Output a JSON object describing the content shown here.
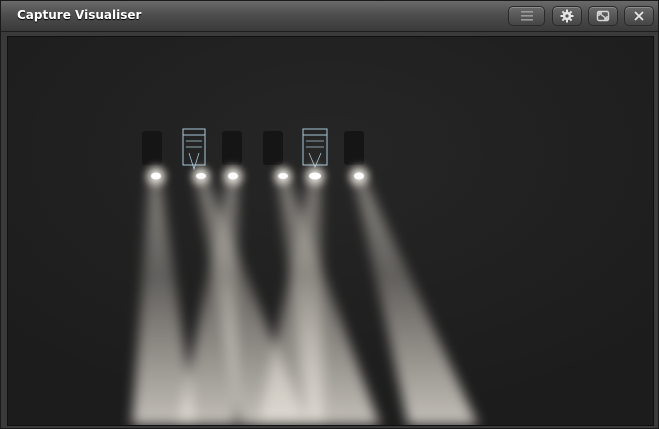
{
  "window": {
    "title": "Capture Visualiser"
  },
  "titlebar_buttons": [
    {
      "name": "menu-button",
      "icon": "hamburger-menu-icon"
    },
    {
      "name": "settings-button",
      "icon": "gear-icon"
    },
    {
      "name": "resize-button",
      "icon": "resize-icon"
    },
    {
      "name": "close-button",
      "icon": "close-icon"
    }
  ],
  "colors": {
    "window_bg": "#3a3a3a",
    "viewport_bg": "#202020",
    "beam": "#d8d2c8",
    "lamp": "#ffffff",
    "fixture_outline": "#a8c8d8"
  },
  "scene": {
    "fixture_count": 6,
    "selected_fixtures": [
      2,
      5
    ]
  }
}
